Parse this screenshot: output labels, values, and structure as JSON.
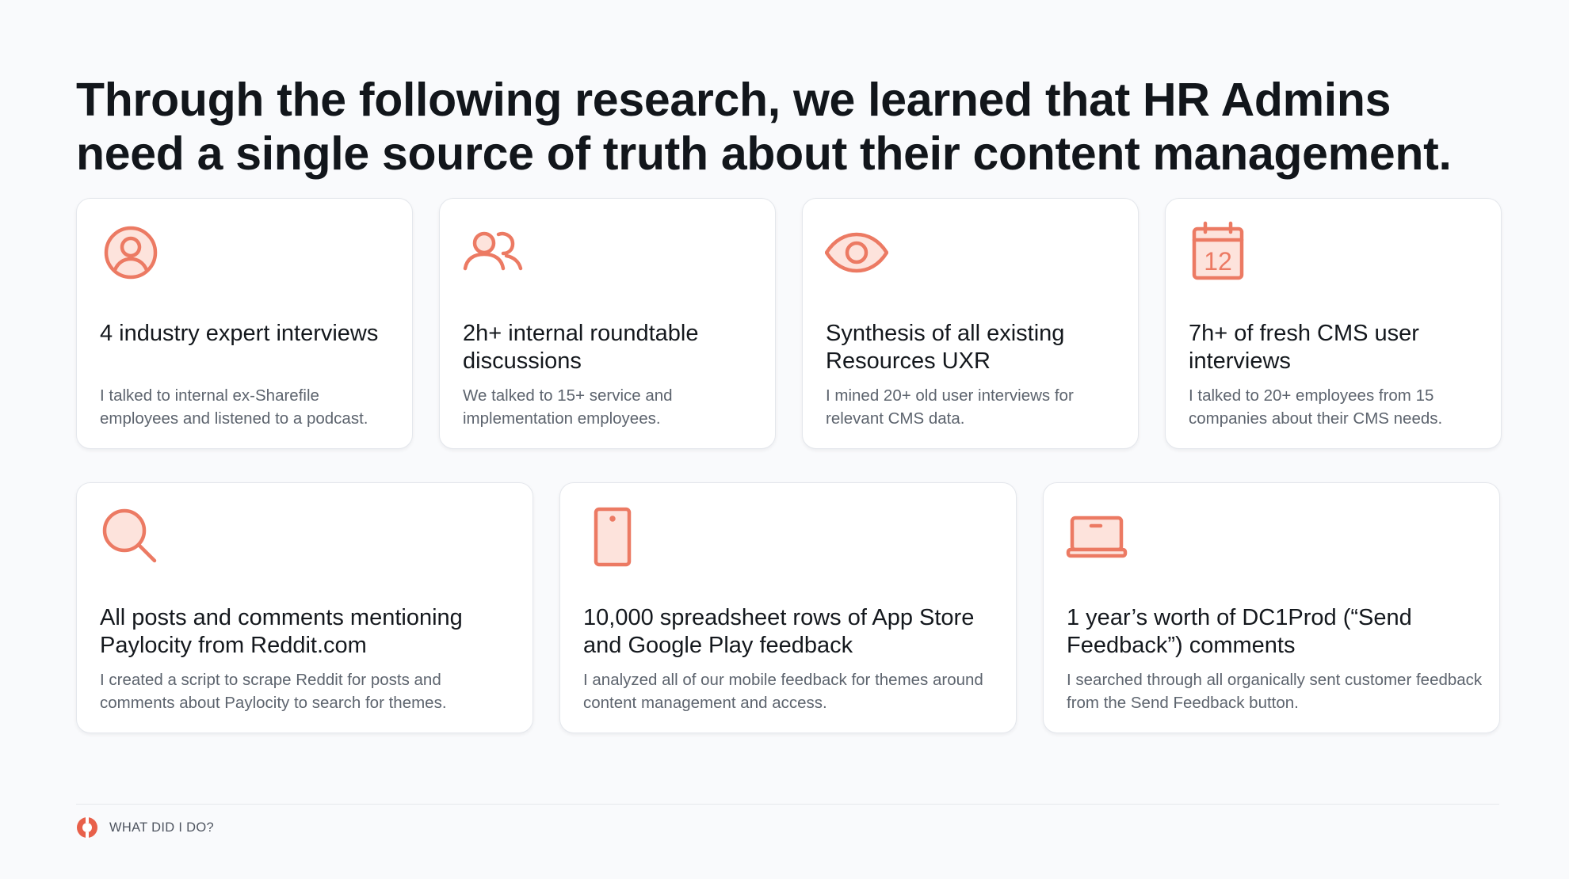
{
  "headline": "Through the following research, we learned that HR Admins need a single source of truth about their content management.",
  "accent_color": "#ec7a63",
  "cards_row_1": [
    {
      "icon": "user-circle-icon",
      "title": "4 industry expert interviews",
      "description": "I talked to internal ex-Sharefile employees and listened to a podcast."
    },
    {
      "icon": "users-icon",
      "title": "2h+ internal roundtable discussions",
      "description": "We talked to 15+ service and implementation employees."
    },
    {
      "icon": "eye-icon",
      "title": "Synthesis of all existing Resources UXR",
      "description": "I mined 20+ old user interviews for relevant CMS data."
    },
    {
      "icon": "calendar-icon",
      "calendar_day": "12",
      "title": "7h+ of fresh CMS user interviews",
      "description": "I talked to 20+ employees from 15 companies about their CMS needs."
    }
  ],
  "cards_row_2": [
    {
      "icon": "search-icon",
      "title": "All posts and comments mentioning Paylocity from Reddit.com",
      "description": "I created a script to scrape Reddit for posts and comments about Paylocity to search for themes."
    },
    {
      "icon": "mobile-phone-icon",
      "title": "10,000 spreadsheet rows of App Store and Google Play feedback",
      "description": "I analyzed all of our mobile feedback for themes around content management and access."
    },
    {
      "icon": "laptop-icon",
      "title": "1 year’s worth of DC1Prod (“Send Feedback”) comments",
      "description": "I searched through all organically sent customer feedback from the Send Feedback button."
    }
  ],
  "footer": {
    "label": "WHAT DID I DO?",
    "logo_icon": "brand-logo-icon"
  }
}
